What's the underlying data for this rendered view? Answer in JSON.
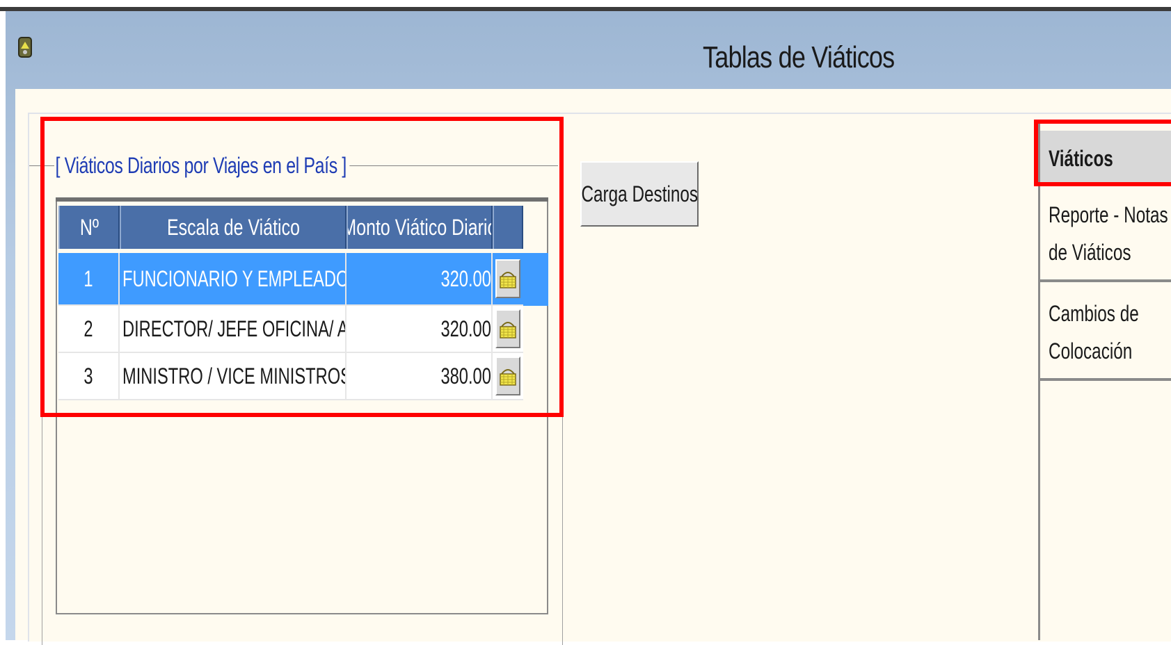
{
  "window": {
    "title": "Tablas de Viáticos",
    "icon": "app-icon"
  },
  "group": {
    "title": "[ Viáticos Diarios por Viajes en el País ]"
  },
  "table": {
    "columns": [
      "Nº",
      "Escala de Viático",
      "Monto Viático Diario",
      ""
    ],
    "rows": [
      {
        "no": "1",
        "escala": "FUNCIONARIO Y EMPLEADOS PU",
        "monto": "320.00",
        "selected": true
      },
      {
        "no": "2",
        "escala": "DIRECTOR/ JEFE OFICINA/ ASES(",
        "monto": "320.00",
        "selected": false
      },
      {
        "no": "3",
        "escala": "MINISTRO / VICE MINISTROS /SE(",
        "monto": "380.00",
        "selected": false
      }
    ],
    "row_button_icon": "basket-icon"
  },
  "buttons": {
    "carga_destinos": "Carga Destinos"
  },
  "side_menu": {
    "items": [
      {
        "label": "Viáticos",
        "active": true
      },
      {
        "label_line1": "Reporte - Notas",
        "label_line2": "de Viáticos"
      },
      {
        "label_line1": "Cambios de",
        "label_line2": "Colocación"
      }
    ]
  },
  "colors": {
    "title_bar": "#b7cce4",
    "header": "#4a6fa8",
    "selection": "#3f9bff",
    "group_title": "#1e3cb4",
    "highlight": "#ff0000",
    "background": "#fffbf0"
  }
}
